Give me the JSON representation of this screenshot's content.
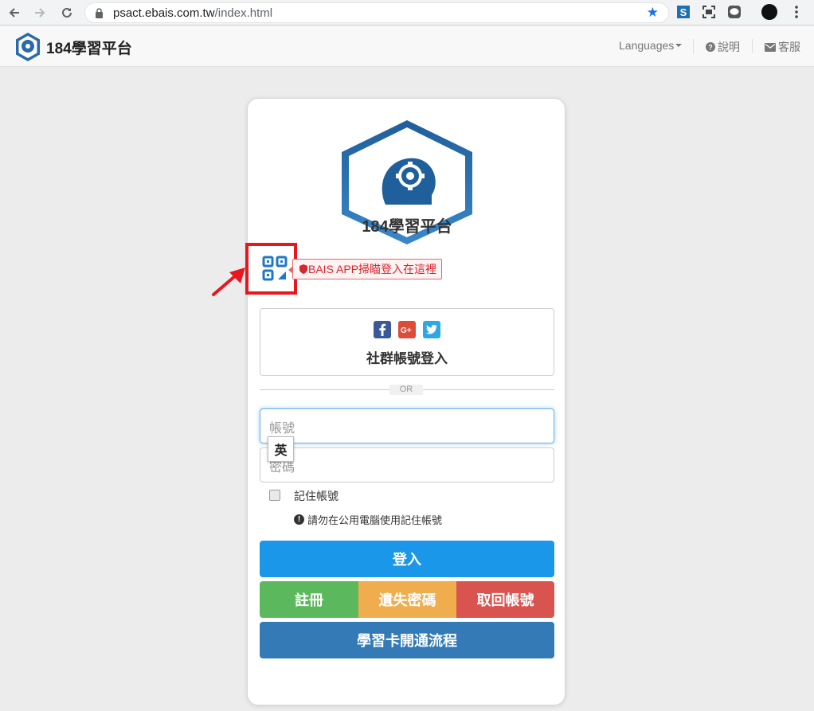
{
  "browser": {
    "url_host": "psact.ebais.com.tw",
    "url_path": "/index.html"
  },
  "header": {
    "title": "184學習平台",
    "languages": "Languages",
    "help": "說明",
    "support": "客服"
  },
  "card": {
    "logo_title": "184學習平台",
    "qr_tip": "BAIS APP掃瞄登入在這裡",
    "social_label": "社群帳號登入",
    "or": "OR",
    "account_placeholder": "帳號",
    "password_placeholder": "密碼",
    "ime_indicator": "英",
    "remember_label": "記住帳號",
    "remember_warning": "請勿在公用電腦使用記住帳號",
    "login_button": "登入",
    "register_button": "註冊",
    "forgot_button": "遺失密碼",
    "retrieve_button": "取回帳號",
    "card_process_button": "學習卡開通流程"
  },
  "icons": {
    "social": [
      "facebook-icon",
      "google-plus-icon",
      "twitter-icon"
    ]
  },
  "colors": {
    "login": "#1a97e8",
    "register": "#5cb85c",
    "forgot": "#f0ad4e",
    "retrieve": "#d9534f",
    "card_process": "#337ab7",
    "highlight": "#e8161e"
  }
}
